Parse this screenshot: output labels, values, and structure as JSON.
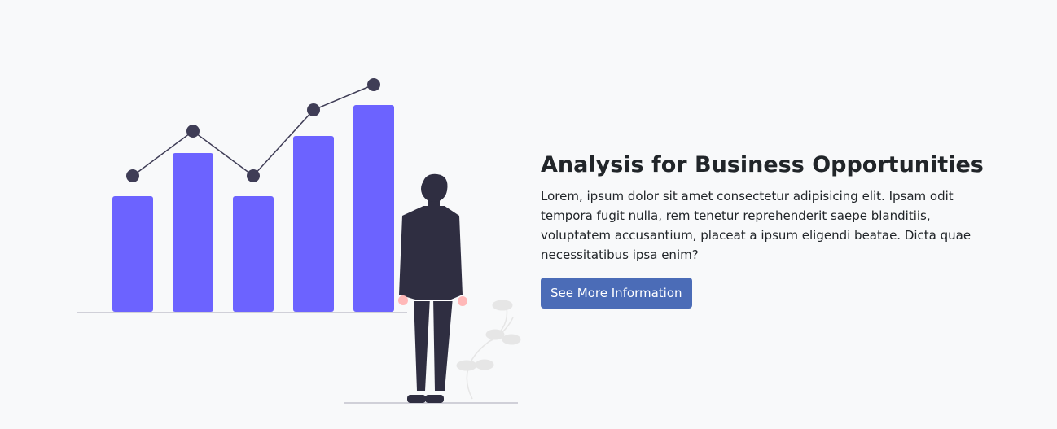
{
  "hero": {
    "title": "Analysis for Business Opportunities",
    "description": "Lorem, ipsum dolor sit amet consectetur adipisicing elit. Ipsam odit tempora fugit nulla, rem tenetur reprehenderit saepe blanditiis, voluptatem accusantium, placeat a ipsum eligendi beatae. Dicta quae necessitatibus ipsa enim?",
    "button_label": "See More Information"
  },
  "illustration": {
    "icon": "business-analytics-illustration",
    "colors": {
      "bars": "#6c63ff",
      "line": "#3f3d56",
      "person": "#2f2e41",
      "skin": "#ffb8b8",
      "ground": "#d0d0d8",
      "plant": "#e6e6e6"
    }
  },
  "chart_data": {
    "type": "bar",
    "categories": [
      "",
      "",
      "",
      "",
      ""
    ],
    "values": [
      142,
      195,
      142,
      216,
      254
    ],
    "line_values": [
      167,
      222,
      167,
      248,
      279
    ]
  }
}
